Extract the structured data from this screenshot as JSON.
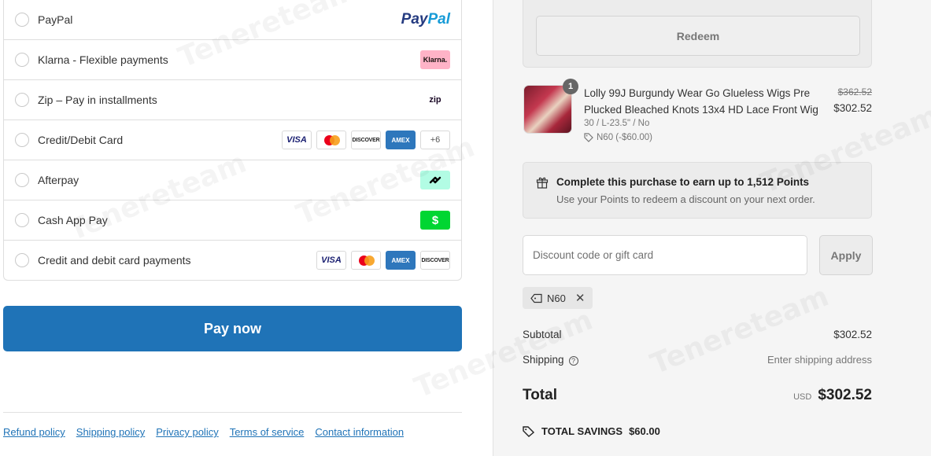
{
  "payment": {
    "methods": [
      {
        "label": "PayPal"
      },
      {
        "label": "Klarna - Flexible payments"
      },
      {
        "label": "Zip – Pay in installments"
      },
      {
        "label": "Credit/Debit Card"
      },
      {
        "label": "Afterpay"
      },
      {
        "label": "Cash App Pay"
      },
      {
        "label": "Credit and debit card payments"
      }
    ],
    "paypal_logo": {
      "part1": "Pay",
      "part2": "Pal"
    },
    "klarna_logo": "Klarna.",
    "zip_logo": "zip",
    "card_logos": {
      "visa": "VISA",
      "discover": "DISCOVER",
      "amex": "AMEX",
      "more": "+6"
    },
    "cashapp_logo": "$"
  },
  "pay_button": "Pay now",
  "footer": {
    "links": [
      "Refund policy",
      "Shipping policy",
      "Privacy policy",
      "Terms of service",
      "Contact information"
    ]
  },
  "summary": {
    "redeem_label": "Redeem",
    "product": {
      "quantity": "1",
      "name": "Lolly 99J Burgundy Wear Go Glueless Wigs Pre Plucked Bleached Knots 13x4 HD Lace Front Wig",
      "variant": "30 / L-23.5\" / No",
      "discount_tag": "N60 (-$60.00)",
      "original_price": "$362.52",
      "price": "$302.52"
    },
    "points": {
      "title": "Complete this purchase to earn up to 1,512 Points",
      "subtitle": "Use your Points to redeem a discount on your next order."
    },
    "discount_input": {
      "placeholder": "Discount code or gift card"
    },
    "apply_label": "Apply",
    "applied_code": "N60",
    "subtotal_label": "Subtotal",
    "subtotal_value": "$302.52",
    "shipping_label": "Shipping",
    "shipping_value": "Enter shipping address",
    "total_label": "Total",
    "total_currency": "USD",
    "total_value": "$302.52",
    "savings_label": "TOTAL SAVINGS",
    "savings_value": "$60.00"
  },
  "colors": {
    "accent": "#1f73b7",
    "panel_bg": "#f5f5f5"
  },
  "watermark_text": "Tenereteam"
}
